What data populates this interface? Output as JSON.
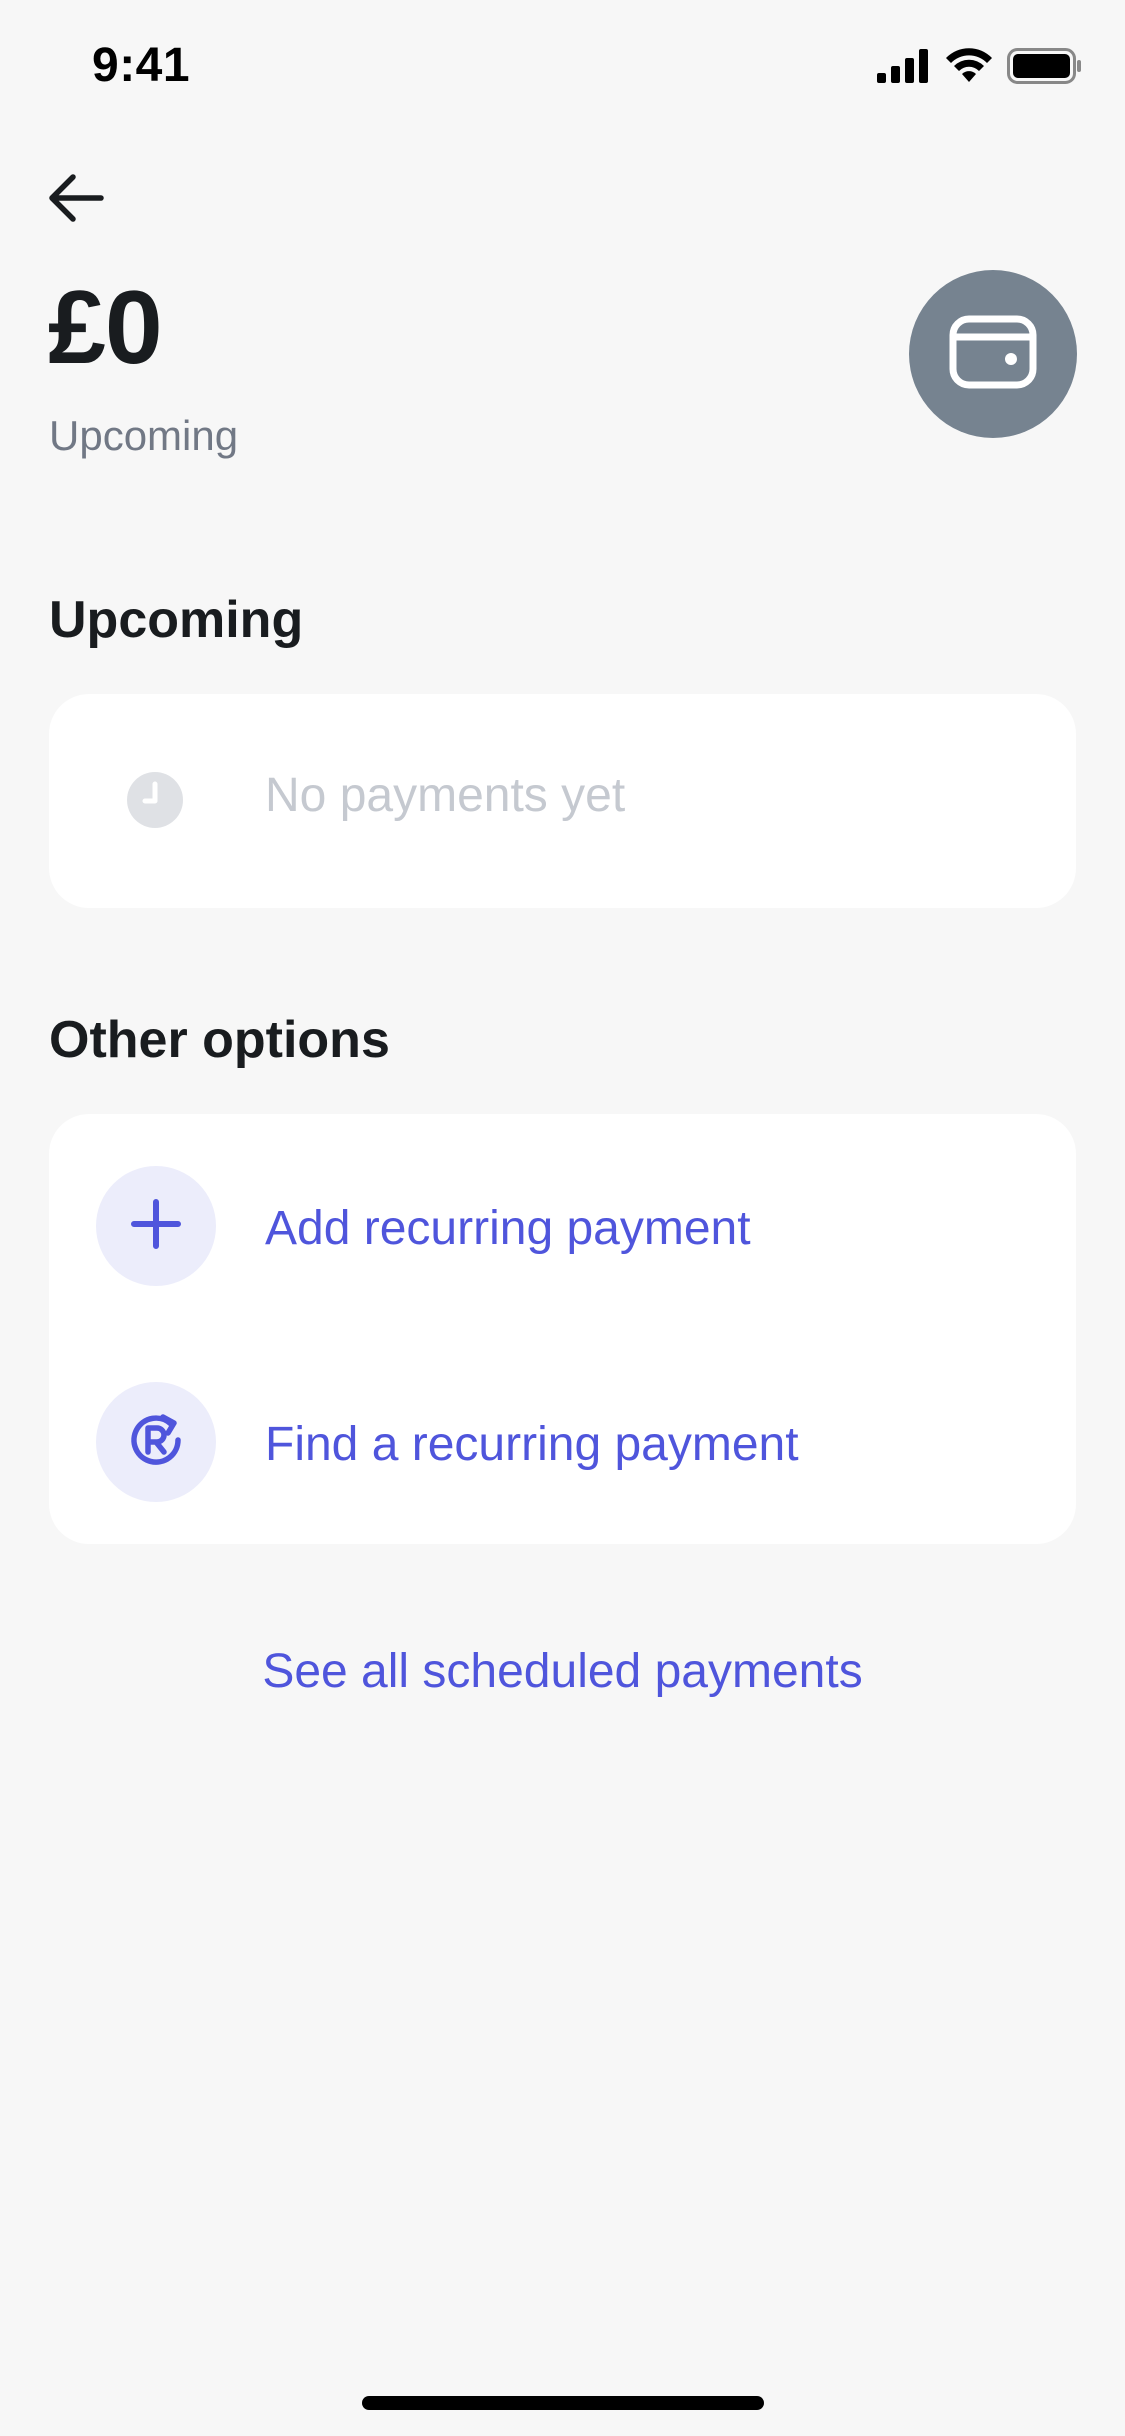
{
  "status_bar": {
    "time": "9:41",
    "signal_icon": "cellular-signal-icon",
    "wifi_icon": "wifi-icon",
    "battery_icon": "battery-icon"
  },
  "header": {
    "back_icon": "arrow-left-icon",
    "amount": "£0",
    "caption": "Upcoming",
    "avatar_icon": "wallet-icon",
    "avatar_color": "#768390"
  },
  "upcoming_section": {
    "title": "Upcoming",
    "empty_icon": "clock-icon",
    "empty_text": "No payments yet"
  },
  "other_options": {
    "title": "Other options",
    "items": [
      {
        "label": "Add recurring payment",
        "icon": "plus-icon"
      },
      {
        "label": "Find a recurring payment",
        "icon": "recurring-search-icon"
      }
    ]
  },
  "footer_link": {
    "label": "See all scheduled payments"
  },
  "colors": {
    "accent": "#4f55dc",
    "accent_bg": "#ecedfb",
    "background": "#f7f7f7",
    "card": "#ffffff",
    "muted_text": "#717885"
  }
}
